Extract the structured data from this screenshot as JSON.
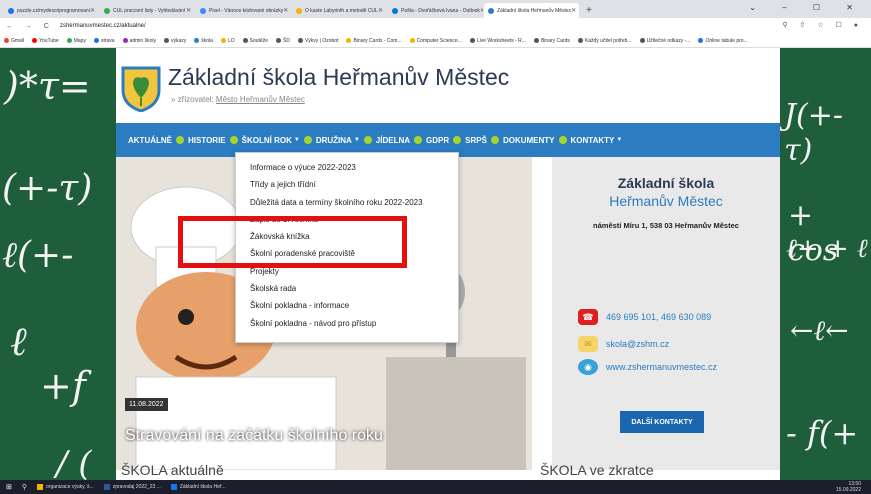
{
  "browser": {
    "tabs": [
      {
        "label": "puzzle.cz/mydescriprogramovani",
        "color": "#1a73e8"
      },
      {
        "label": "CUL pracovní listy - Vyhledávání",
        "color": "#34a853"
      },
      {
        "label": "Pixel - Vánoce kódované obrázky",
        "color": "#4285f4"
      },
      {
        "label": "O kaste Labyrinth a metodě CUL",
        "color": "#f4b400"
      },
      {
        "label": "Pošta - Dvořáčková Ivana - Outlook",
        "color": "#0078d4"
      },
      {
        "label": "Základní škola Heřmanův Městec",
        "color": "#2b7cc0",
        "active": true
      }
    ],
    "new_tab": "+",
    "window_controls": "⌄ – ☐ ✕",
    "nav": "← → C",
    "url": "zshermanuvmestec.cz/aktualne/",
    "toolbar_icons": "⚲ ⇧ ☆ ☐ ●",
    "bookmarks": [
      {
        "label": "Gmail",
        "color": "#ea4335"
      },
      {
        "label": "YouTube",
        "color": "#ff0000"
      },
      {
        "label": "Mapy",
        "color": "#34a853"
      },
      {
        "label": "strava",
        "color": "#1a73e8"
      },
      {
        "label": "admin školy",
        "color": "#9c27b0"
      },
      {
        "label": "výkazy",
        "color": "#555555"
      },
      {
        "label": "škola",
        "color": "#2b7cc0"
      },
      {
        "label": "LO",
        "color": "#f4b400"
      },
      {
        "label": "Soutěže",
        "color": "#555555"
      },
      {
        "label": "ŠD",
        "color": "#555555"
      },
      {
        "label": "Výkvy | Ozobot",
        "color": "#555555"
      },
      {
        "label": "Binary Cards - Com...",
        "color": "#f4b400"
      },
      {
        "label": "Computer Science...",
        "color": "#f4b400"
      },
      {
        "label": "Live Worksheets - R...",
        "color": "#555555"
      },
      {
        "label": "Binary Cards",
        "color": "#555555"
      },
      {
        "label": "Každý učitel potřeb...",
        "color": "#555555"
      },
      {
        "label": "Užitečné odkazy -...",
        "color": "#555555"
      },
      {
        "label": "Online tabule pro...",
        "color": "#1a73e8"
      }
    ]
  },
  "site": {
    "title": "Základní škola Heřmanův Městec",
    "subtitle_prefix": "» zřizovatel:",
    "subtitle_link": "Město Heřmanův Městec",
    "menu": [
      {
        "label": "AKTUÁLNĚ",
        "caret": false
      },
      {
        "label": "HISTORIE",
        "caret": false
      },
      {
        "label": "ŠKOLNÍ ROK",
        "caret": true
      },
      {
        "label": "DRUŽINA",
        "caret": true
      },
      {
        "label": "JÍDELNA",
        "caret": false
      },
      {
        "label": "GDPR",
        "caret": false
      },
      {
        "label": "SRPŠ",
        "caret": false
      },
      {
        "label": "DOKUMENTY",
        "caret": false
      },
      {
        "label": "KONTAKTY",
        "caret": true
      }
    ],
    "dropdown": [
      "Informace o výuce 2022-2023",
      "Třídy a jejich třídní",
      "Důležitá data a termíny školního roku 2022-2023",
      "Zápis do 1. ročníku",
      "Žákovská knížka",
      "Školní poradenské pracoviště",
      "Projekty",
      "Školská rada",
      "Školní pokladna - informace",
      "Školní pokladna - návod pro přístup"
    ],
    "hero": {
      "date": "11.08.2022",
      "title": "Stravování na začátku školního roku"
    },
    "info": {
      "school": "Základní škola",
      "town": "Heřmanův Městec",
      "address": "náměstí Míru 1, 538 03 Heřmanův Městec",
      "phone": "469 695 101, 469 630 089",
      "email": "skola@zshm.cz",
      "web": "www.zshermanuvmestec.cz",
      "more_button": "DALŠÍ KONTAKTY"
    },
    "section_left": "ŠKOLA aktuálně",
    "section_right": "ŠKOLA ve zkratce"
  },
  "chalk": {
    "left1": ")*τ=",
    "left2": "(+-τ)",
    "left3": "ℓ(+-",
    "left4": "ℓ",
    "left5": "+f",
    "left6": "/ (",
    "right1": "J(+-τ)",
    "right2": "+ cos",
    "right3": "ℓ+ + ℓ",
    "right4": "←ℓ←",
    "right5": "- f(+"
  },
  "taskbar": {
    "items": [
      {
        "label": "organizace výuky, š...",
        "color": "#f4b400"
      },
      {
        "label": "zpravodaj 2022_23 ...",
        "color": "#2b579a"
      },
      {
        "label": "Základní škola Heř...",
        "color": "#1a73e8"
      }
    ],
    "time": "13:50",
    "date": "15.09.2022"
  },
  "colors": {
    "menu_bg": "#2b7cc0",
    "menu_dot": "#a6d62b",
    "highlight": "#e41010",
    "board": "#1f5e3a"
  }
}
